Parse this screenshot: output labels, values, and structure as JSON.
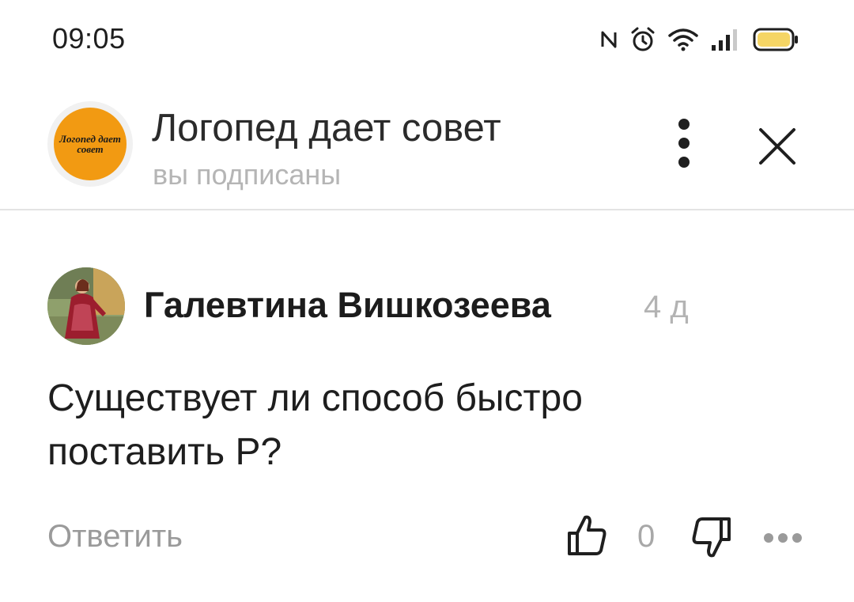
{
  "status_bar": {
    "time": "09:05",
    "icons": [
      "nfc-icon",
      "alarm-icon",
      "wifi-icon",
      "signal-icon",
      "battery-icon"
    ],
    "battery_color": "#f5d565"
  },
  "channel": {
    "avatar_text": "Логопед дает совет",
    "avatar_color": "#f29a12",
    "title": "Логопед дает совет",
    "subtitle": "вы подписаны"
  },
  "comment": {
    "author": "Галевтина Вишкозеева",
    "age": "4 д",
    "text": "Существует ли способ быстро поставить Р?",
    "reply_label": "Ответить",
    "likes": "0"
  }
}
